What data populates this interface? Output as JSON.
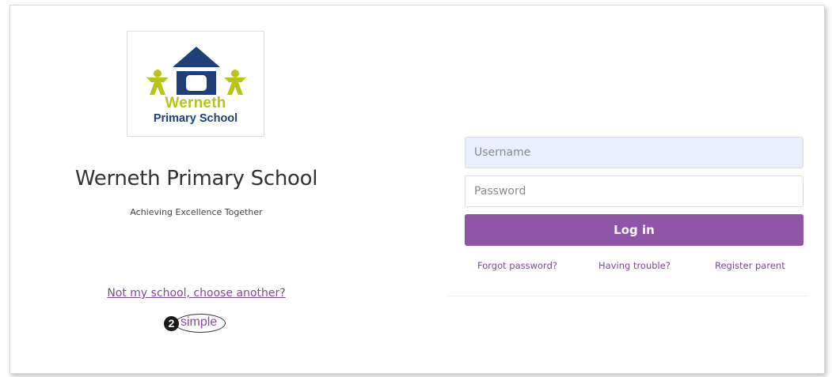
{
  "school": {
    "logo_text_line1": "Werneth",
    "logo_text_line2": "Primary School",
    "name": "Werneth Primary School",
    "motto": "Achieving Excellence Together"
  },
  "links": {
    "choose_another": "Not my school, choose another?",
    "forgot_password": "Forgot password?",
    "having_trouble": "Having trouble?",
    "register_parent": "Register parent"
  },
  "form": {
    "username_placeholder": "Username",
    "password_placeholder": "Password",
    "login_label": "Log in"
  },
  "brand": {
    "number": "2",
    "word": "simple"
  },
  "colors": {
    "accent_purple": "#8e55a6",
    "link_purple": "#7a4a94",
    "logo_navy": "#1f3f7a",
    "logo_lime": "#b8c41a",
    "username_bg": "#e8eefb"
  },
  "icons": {
    "school_logo": "school-house-children-logo",
    "brand_logo": "2simple-logo"
  }
}
